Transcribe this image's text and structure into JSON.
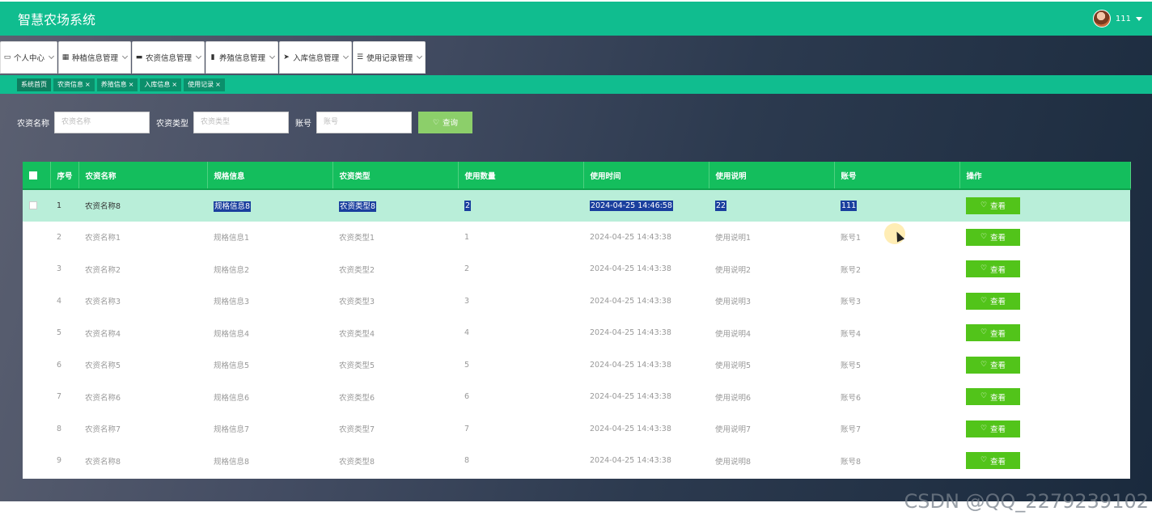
{
  "app": {
    "title": "智慧农场系统",
    "username": "111"
  },
  "menu": [
    {
      "label": "个人中心",
      "icon": "calendar-icon"
    },
    {
      "label": "种植信息管理",
      "icon": "grid-icon"
    },
    {
      "label": "农资信息管理",
      "icon": "chat-icon"
    },
    {
      "label": "养殖信息管理",
      "icon": "bar-chart-icon"
    },
    {
      "label": "入库信息管理",
      "icon": "send-icon"
    },
    {
      "label": "使用记录管理",
      "icon": "list-icon"
    }
  ],
  "tags": [
    {
      "label": "系统首页",
      "closable": false
    },
    {
      "label": "农资信息",
      "closable": true
    },
    {
      "label": "养殖信息",
      "closable": true
    },
    {
      "label": "入库信息",
      "closable": true
    },
    {
      "label": "使用记录",
      "closable": true
    }
  ],
  "tag_close": "×",
  "search": {
    "name_label": "农资名称",
    "name_placeholder": "农资名称",
    "type_label": "农资类型",
    "type_placeholder": "农资类型",
    "account_label": "账号",
    "account_placeholder": "账号",
    "query_label": "查询"
  },
  "table": {
    "columns": [
      "序号",
      "农资名称",
      "规格信息",
      "农资类型",
      "使用数量",
      "使用时间",
      "使用说明",
      "账号",
      "操作"
    ],
    "action_label": "查看",
    "rows": [
      [
        "1",
        "农资名称8",
        "规格信息8",
        "农资类型8",
        "2",
        "2024-04-25 14:46:58",
        "22",
        "111"
      ],
      [
        "2",
        "农资名称1",
        "规格信息1",
        "农资类型1",
        "1",
        "2024-04-25 14:43:38",
        "使用说明1",
        "账号1"
      ],
      [
        "3",
        "农资名称2",
        "规格信息2",
        "农资类型2",
        "2",
        "2024-04-25 14:43:38",
        "使用说明2",
        "账号2"
      ],
      [
        "4",
        "农资名称3",
        "规格信息3",
        "农资类型3",
        "3",
        "2024-04-25 14:43:38",
        "使用说明3",
        "账号3"
      ],
      [
        "5",
        "农资名称4",
        "规格信息4",
        "农资类型4",
        "4",
        "2024-04-25 14:43:38",
        "使用说明4",
        "账号4"
      ],
      [
        "6",
        "农资名称5",
        "规格信息5",
        "农资类型5",
        "5",
        "2024-04-25 14:43:38",
        "使用说明5",
        "账号5"
      ],
      [
        "7",
        "农资名称6",
        "规格信息6",
        "农资类型6",
        "6",
        "2024-04-25 14:43:38",
        "使用说明6",
        "账号6"
      ],
      [
        "8",
        "农资名称7",
        "规格信息7",
        "农资类型7",
        "7",
        "2024-04-25 14:43:38",
        "使用说明7",
        "账号7"
      ],
      [
        "9",
        "农资名称8",
        "规格信息8",
        "农资类型8",
        "8",
        "2024-04-25 14:43:38",
        "使用说明8",
        "账号8"
      ]
    ]
  },
  "watermark": "CSDN @QQ_2279239102"
}
